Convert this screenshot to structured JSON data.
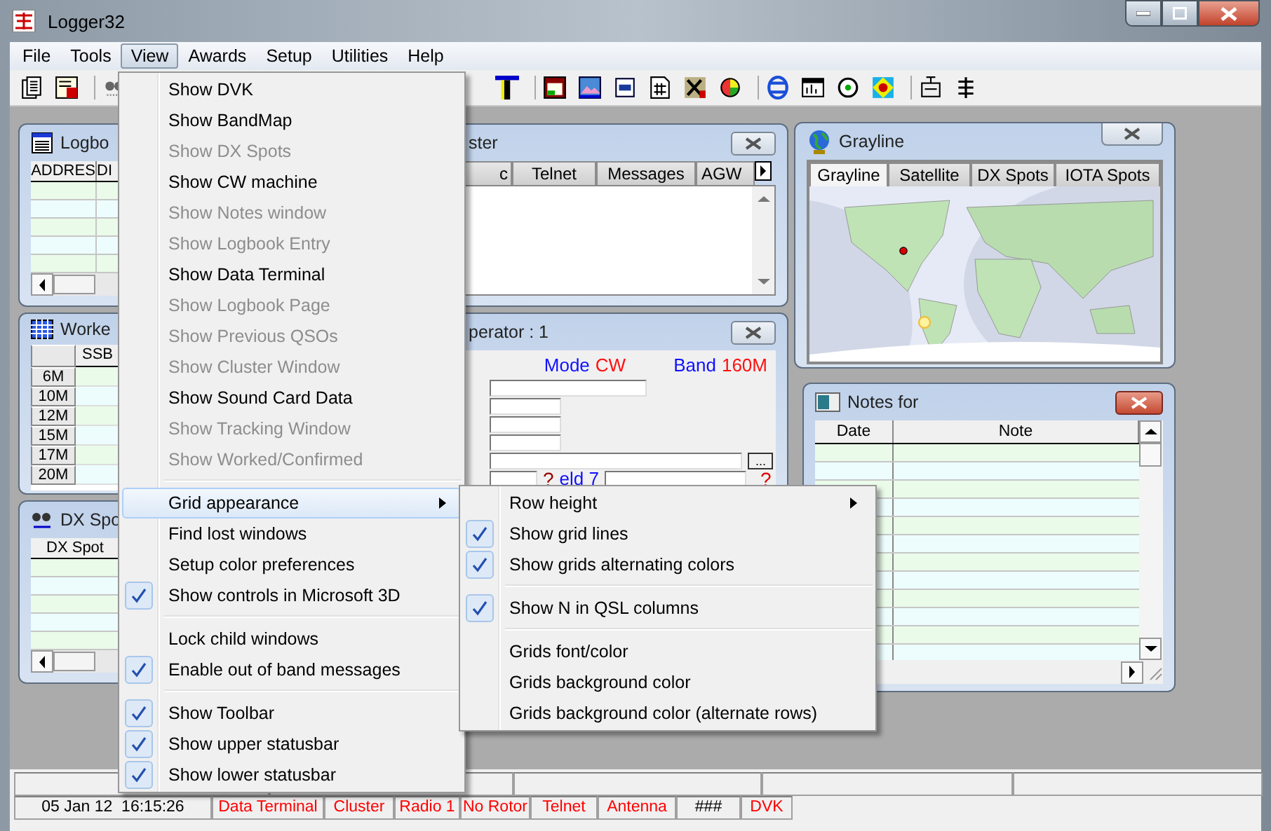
{
  "window": {
    "title": "Logger32"
  },
  "menu_bar": [
    {
      "label": "File",
      "selected": false
    },
    {
      "label": "Tools",
      "selected": false
    },
    {
      "label": "View",
      "selected": true
    },
    {
      "label": "Awards",
      "selected": false
    },
    {
      "label": "Setup",
      "selected": false
    },
    {
      "label": "Utilities",
      "selected": false
    },
    {
      "label": "Help",
      "selected": false
    }
  ],
  "logbook_window": {
    "title": "Logbo",
    "columns": [
      "ADDRES",
      "DI"
    ]
  },
  "cluster_window": {
    "title": "ster",
    "tabs": [
      {
        "label": "c",
        "selected": false
      },
      {
        "label": "Telnet",
        "selected": false
      },
      {
        "label": "Messages",
        "selected": false
      },
      {
        "label": "AGW",
        "selected": false
      }
    ]
  },
  "worked_window": {
    "title": "Worke",
    "columns": [
      "SSB"
    ],
    "rows": [
      "6M",
      "10M",
      "12M",
      "15M",
      "17M",
      "20M"
    ]
  },
  "operator_window": {
    "title": "perator : 1",
    "mode_label": "Mode",
    "mode": "CW",
    "band_label": "Band",
    "band": "160M",
    "field_label": "eld 7",
    "mark": "?",
    "mark_right": "?",
    "browse_button": "..."
  },
  "dx_spot_window": {
    "title": "DX Spo",
    "columns": [
      "DX Spot"
    ]
  },
  "grayline_window": {
    "title": "Grayline",
    "tabs": [
      {
        "label": "Grayline",
        "selected": true
      },
      {
        "label": "Satellite",
        "selected": false
      },
      {
        "label": "DX Spots",
        "selected": false
      },
      {
        "label": "IOTA Spots",
        "selected": false
      }
    ]
  },
  "notes_window": {
    "title": "Notes for",
    "columns": [
      "Date",
      "Note"
    ]
  },
  "view_menu": {
    "items": [
      {
        "kind": "item",
        "label": "Show DVK",
        "disabled": false,
        "checked": false,
        "selected": false
      },
      {
        "kind": "item",
        "label": "Show BandMap",
        "disabled": false,
        "checked": false,
        "selected": false
      },
      {
        "kind": "item",
        "label": "Show DX Spots",
        "disabled": true,
        "checked": false,
        "selected": false
      },
      {
        "kind": "item",
        "label": "Show CW machine",
        "disabled": false,
        "checked": false,
        "selected": false
      },
      {
        "kind": "item",
        "label": "Show Notes window",
        "disabled": true,
        "checked": false,
        "selected": false
      },
      {
        "kind": "item",
        "label": "Show Logbook Entry",
        "disabled": true,
        "checked": false,
        "selected": false
      },
      {
        "kind": "item",
        "label": "Show Data Terminal",
        "disabled": false,
        "checked": false,
        "selected": false
      },
      {
        "kind": "item",
        "label": "Show Logbook Page",
        "disabled": true,
        "checked": false,
        "selected": false
      },
      {
        "kind": "item",
        "label": "Show Previous QSOs",
        "disabled": true,
        "checked": false,
        "selected": false
      },
      {
        "kind": "item",
        "label": "Show Cluster Window",
        "disabled": true,
        "checked": false,
        "selected": false
      },
      {
        "kind": "item",
        "label": "Show Sound Card Data",
        "disabled": false,
        "checked": false,
        "selected": false
      },
      {
        "kind": "item",
        "label": "Show Tracking Window",
        "disabled": true,
        "checked": false,
        "selected": false
      },
      {
        "kind": "item",
        "label": "Show Worked/Confirmed",
        "disabled": true,
        "checked": false,
        "selected": false
      },
      {
        "kind": "separator"
      },
      {
        "kind": "submenu",
        "label": "Grid appearance",
        "disabled": false,
        "checked": false,
        "selected": true
      },
      {
        "kind": "item",
        "label": "Find lost windows",
        "disabled": false,
        "checked": false,
        "selected": false
      },
      {
        "kind": "item",
        "label": "Setup color preferences",
        "disabled": false,
        "checked": false,
        "selected": false
      },
      {
        "kind": "item",
        "label": "Show controls in Microsoft 3D",
        "disabled": false,
        "checked": true,
        "selected": false
      },
      {
        "kind": "separator"
      },
      {
        "kind": "item",
        "label": "Lock child windows",
        "disabled": false,
        "checked": false,
        "selected": false
      },
      {
        "kind": "item",
        "label": "Enable out of band messages",
        "disabled": false,
        "checked": true,
        "selected": false
      },
      {
        "kind": "separator"
      },
      {
        "kind": "item",
        "label": "Show Toolbar",
        "disabled": false,
        "checked": true,
        "selected": false
      },
      {
        "kind": "item",
        "label": "Show upper statusbar",
        "disabled": false,
        "checked": true,
        "selected": false
      },
      {
        "kind": "item",
        "label": "Show lower statusbar",
        "disabled": false,
        "checked": true,
        "selected": false
      }
    ]
  },
  "grid_submenu": {
    "items": [
      {
        "kind": "submenu",
        "label": "Row height",
        "disabled": false,
        "checked": false,
        "selected": false
      },
      {
        "kind": "item",
        "label": "Show grid lines",
        "disabled": false,
        "checked": true,
        "selected": false
      },
      {
        "kind": "item",
        "label": "Show grids alternating colors",
        "disabled": false,
        "checked": true,
        "selected": false
      },
      {
        "kind": "separator"
      },
      {
        "kind": "item",
        "label": "Show N in QSL columns",
        "disabled": false,
        "checked": true,
        "selected": false
      },
      {
        "kind": "separator"
      },
      {
        "kind": "item",
        "label": "Grids font/color",
        "disabled": false,
        "checked": false,
        "selected": false
      },
      {
        "kind": "item",
        "label": "Grids background color",
        "disabled": false,
        "checked": false,
        "selected": false
      },
      {
        "kind": "item",
        "label": "Grids background color (alternate rows)",
        "disabled": false,
        "checked": false,
        "selected": false
      }
    ]
  },
  "status_bar": {
    "cells": [
      {
        "text": "05 Jan 12  16:15:26",
        "color": "#000000"
      },
      {
        "text": "Data Terminal",
        "color": "#ff0000"
      },
      {
        "text": "Cluster",
        "color": "#ff0000"
      },
      {
        "text": "Radio 1",
        "color": "#ff0000"
      },
      {
        "text": "No Rotor",
        "color": "#ff0000"
      },
      {
        "text": "Telnet",
        "color": "#ff0000"
      },
      {
        "text": "Antenna",
        "color": "#ff0000"
      },
      {
        "text": "###",
        "color": "#000000"
      },
      {
        "text": "DVK",
        "color": "#ff0000"
      }
    ]
  }
}
